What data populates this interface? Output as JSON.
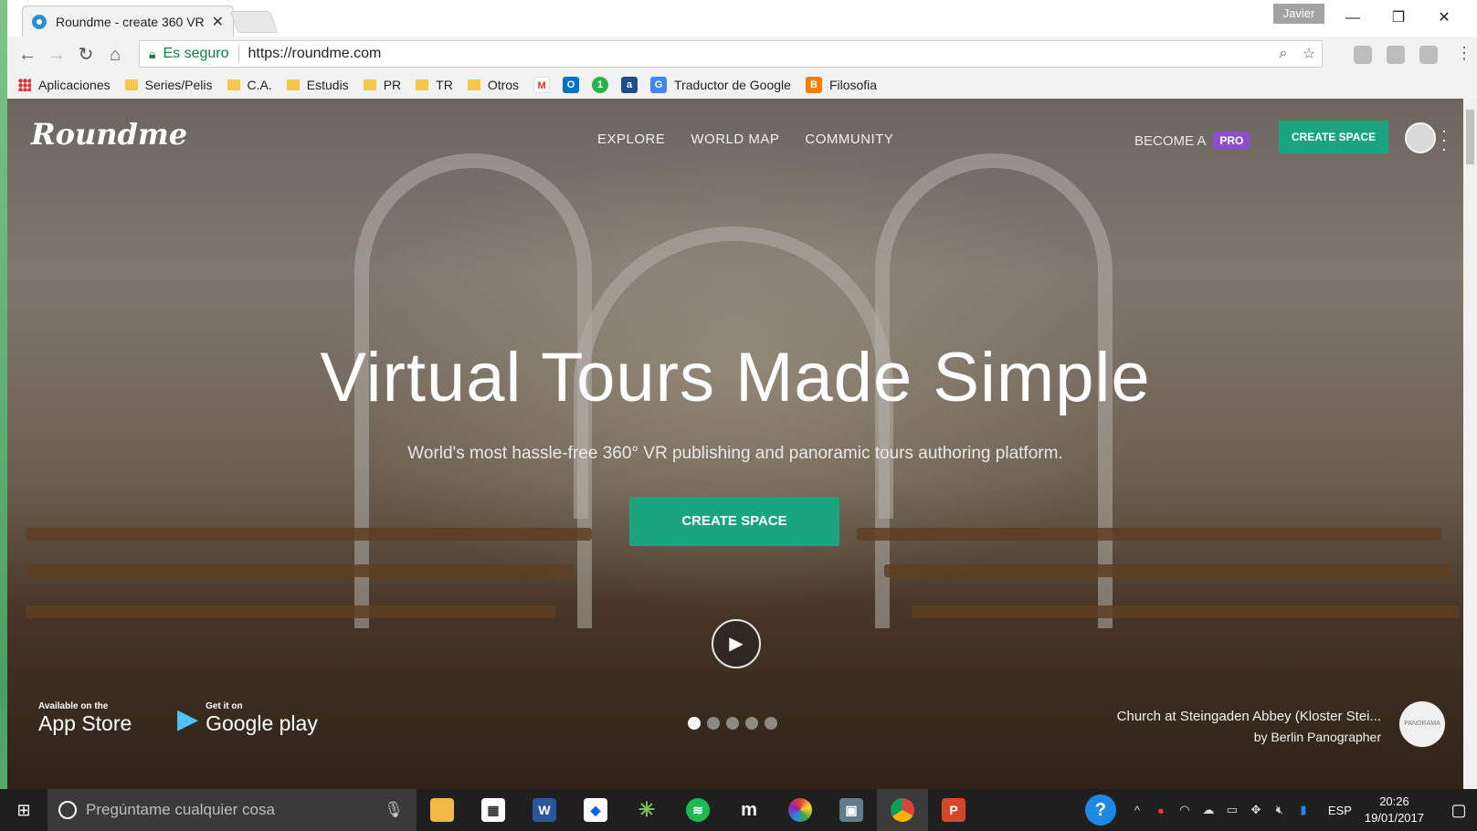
{
  "browser": {
    "tab_title": "Roundme - create 360 VR",
    "user_badge": "Javier",
    "address": {
      "secure_label": "Es seguro",
      "url": "https://roundme.com"
    },
    "bookmarks": [
      {
        "label": "Aplicaciones",
        "icon": "apps-icon"
      },
      {
        "label": "Series/Pelis",
        "icon": "folder-icon"
      },
      {
        "label": "C.A.",
        "icon": "folder-icon"
      },
      {
        "label": "Estudis",
        "icon": "folder-icon"
      },
      {
        "label": "PR",
        "icon": "folder-icon"
      },
      {
        "label": "TR",
        "icon": "folder-icon"
      },
      {
        "label": "Otros",
        "icon": "folder-icon"
      },
      {
        "label": "Traductor de Google",
        "icon": "google-translate-icon"
      },
      {
        "label": "Filosofia",
        "icon": "blogger-icon"
      }
    ]
  },
  "site": {
    "logo": "Roundme",
    "nav": [
      "EXPLORE",
      "WORLD MAP",
      "COMMUNITY"
    ],
    "become_label": "BECOME A",
    "pro_label": "PRO",
    "create_space_top": "CREATE SPACE",
    "hero": {
      "title": "Virtual Tours Made Simple",
      "subtitle": "World's most hassle-free 360° VR publishing and panoramic tours authoring platform.",
      "cta": "CREATE SPACE"
    },
    "app_store": {
      "small": "Available on the",
      "big": "App Store"
    },
    "google_play": {
      "small": "Get it on",
      "big": "Google play"
    },
    "slides": {
      "count": 5,
      "active": 0
    },
    "panorama": {
      "name": "Church at Steingaden Abbey (Kloster Stei...",
      "author": "by Berlin Panographer",
      "badge": "PANORAMA"
    }
  },
  "taskbar": {
    "search_placeholder": "Pregúntame cualquier cosa",
    "apps": [
      "file-explorer-icon",
      "calendar-icon",
      "word-icon",
      "dropbox-icon",
      "wunderlist-icon",
      "spotify-icon",
      "mendeley-icon",
      "color-picker-icon",
      "screen-capture-icon",
      "chrome-icon",
      "powerpoint-icon"
    ],
    "language": "ESP",
    "time": "20:26",
    "date": "19/01/2017"
  },
  "colors": {
    "accent": "#1aa57f",
    "pro": "#8a4fc9"
  }
}
